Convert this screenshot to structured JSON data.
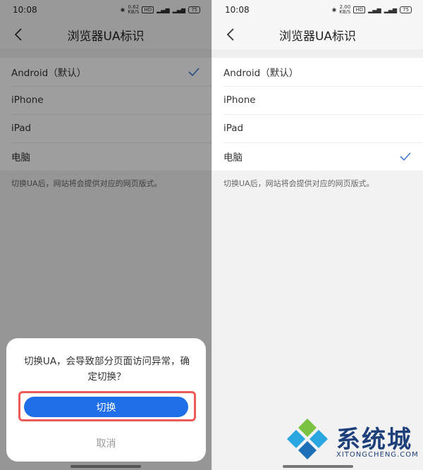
{
  "left": {
    "status_time": "10:08",
    "status_rate": "0.62\nKB/S",
    "title": "浏览器UA标识",
    "options": [
      "Android（默认）",
      "iPhone",
      "iPad",
      "电脑"
    ],
    "selected_index": 0,
    "note": "切换UA后，网站将会提供对应的网页版式。",
    "dialog": {
      "message": "切换UA，会导致部分页面访问异常，确定切换？",
      "confirm_label": "切换",
      "cancel_label": "取消"
    },
    "battery": "75"
  },
  "right": {
    "status_time": "10:08",
    "status_rate": "2.00\nKB/S",
    "title": "浏览器UA标识",
    "options": [
      "Android（默认）",
      "iPhone",
      "iPad",
      "电脑"
    ],
    "selected_index": 3,
    "note": "切换UA后，网站将会提供对应的网页版式。",
    "battery": "75"
  },
  "watermark": {
    "brand": "系统城",
    "domain": "XITONGCHENG.COM"
  },
  "colors": {
    "accent": "#1e6fe8",
    "check": "#3a7bd5",
    "highlight": "#ec5a5a"
  },
  "icons": [
    "back-arrow-icon",
    "checkmark-icon",
    "bluetooth-icon",
    "signal-icon",
    "battery-icon"
  ]
}
